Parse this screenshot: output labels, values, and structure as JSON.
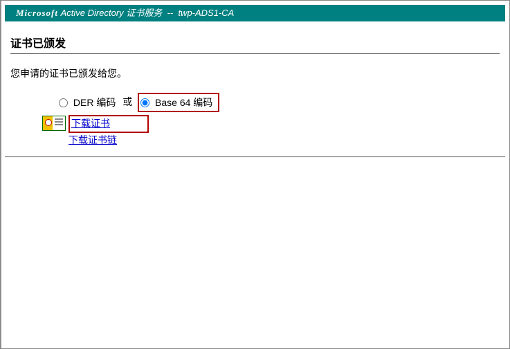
{
  "banner": {
    "brand": "Microsoft",
    "product": "Active Directory",
    "service_label": "证书服务",
    "separator": "--",
    "ca_name": "twp-ADS1-CA"
  },
  "page_title": "证书已颁发",
  "message": "您申请的证书已颁发给您。",
  "encoding": {
    "der_label": "DER 编码",
    "or_label": "或",
    "base64_label": "Base 64 编码",
    "selected": "base64"
  },
  "downloads": {
    "download_cert": "下载证书",
    "download_chain": "下载证书链"
  }
}
